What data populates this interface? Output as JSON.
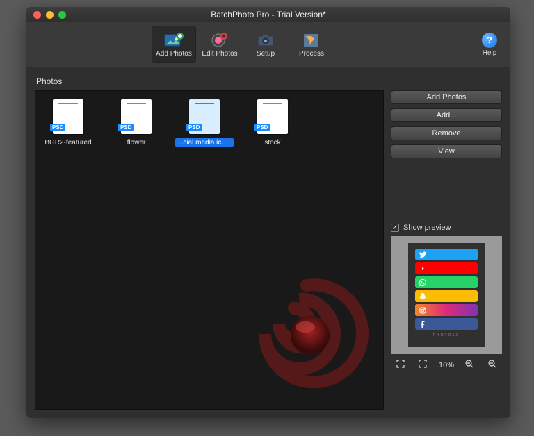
{
  "window": {
    "title": "BatchPhoto Pro - Trial Version*"
  },
  "toolbar": {
    "add_photos": "Add Photos",
    "edit_photos": "Edit Photos",
    "setup": "Setup",
    "process": "Process",
    "help": "Help"
  },
  "panel": {
    "title": "Photos"
  },
  "files": [
    {
      "name": "BGR2-featured",
      "badge": "PSD",
      "selected": false
    },
    {
      "name": "flower",
      "badge": "PSD",
      "selected": false
    },
    {
      "name": "...cial media icons",
      "badge": "PSD",
      "selected": true
    },
    {
      "name": "stock",
      "badge": "PSD",
      "selected": false
    }
  ],
  "sidebar": {
    "buttons": [
      "Add Photos",
      "Add...",
      "Remove",
      "View"
    ],
    "show_preview": "Show preview"
  },
  "preview": {
    "watermark": "PHOTOSC",
    "zoom_label": "10%"
  }
}
